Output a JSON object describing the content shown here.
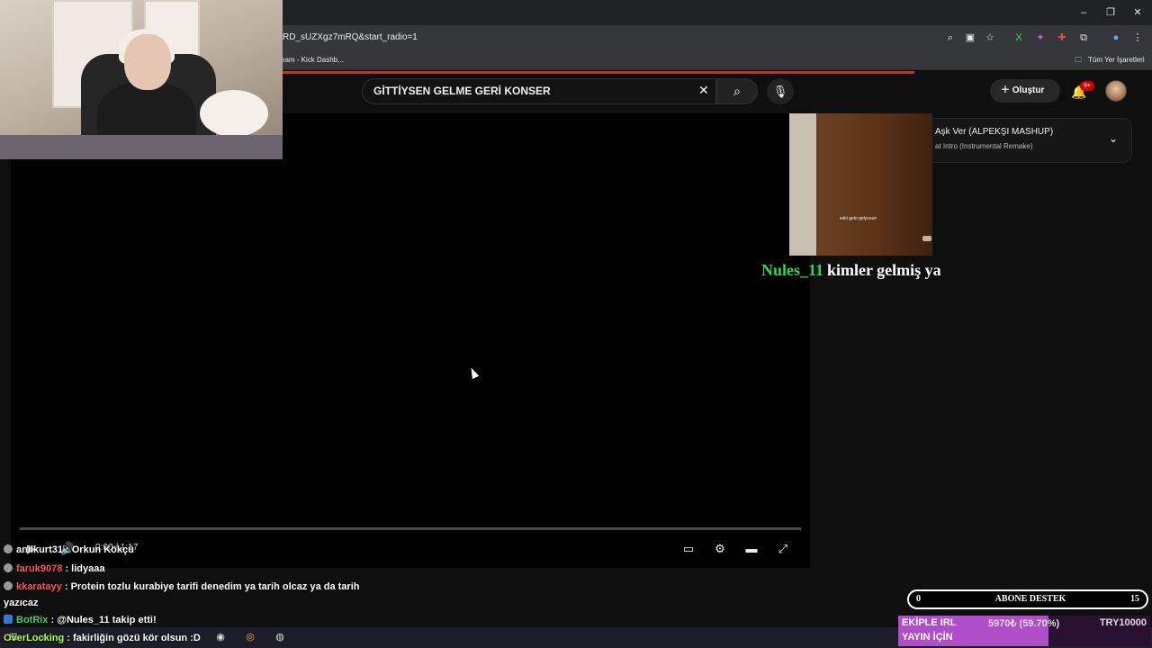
{
  "browser": {
    "url": "RD_sUZXgz7mRQ&start_radio=1",
    "bookmark_left": "eam - Kick Dashb...",
    "bookmark_right": "Tüm Yer İşaretleri",
    "progress_loaded": 0.794
  },
  "youtube": {
    "search_value": "GİTTİYSEN GELME GERİ KONSER",
    "create_label": "Oluştur",
    "notif_badge": "9+",
    "playlist": {
      "title": "Aşk Ver (ALPEKŞI MASHUP)",
      "subtitle": "at Intro (Instrumental Remake)"
    },
    "player": {
      "time": "0:00 / 1:17",
      "progress": 0.0
    }
  },
  "overlay": {
    "thumb_caption": "eski gelo gelyosun",
    "alert_user": "Nules_11",
    "alert_message": "kimler gelmiş ya"
  },
  "chat": [
    {
      "user": "anilkurt31",
      "message": ": Orkun Kökçü"
    },
    {
      "user": "faruk9078",
      "message": ": lidyaaa"
    },
    {
      "user": "kkaratayy",
      "message": ": Protein tozlu kurabiye tarifi denedim ya tarih olcaz ya da tarih"
    },
    {
      "user": "",
      "message": "yazıcaz"
    },
    {
      "user": "BotRix",
      "message": ": @Nules_11 takip etti!"
    },
    {
      "user": "OverLocking",
      "message": ": fakirliğin gözü kör olsun :D"
    }
  ],
  "widgets": {
    "sub_left": "0",
    "sub_label": "ABONE DESTEK",
    "sub_right": "15",
    "goal_title_1": "EKİPLE IRL",
    "goal_title_2": "YAYIN İÇİN",
    "goal_value": "5970₺ (59.70%)",
    "goal_target": "TRY10000",
    "goal_fraction": 0.597
  },
  "colors": {
    "accent": "#c4302b",
    "alert_user": "#2dd65b",
    "chat_user": "#ff5252",
    "goal_fill": "#b04dc8"
  }
}
